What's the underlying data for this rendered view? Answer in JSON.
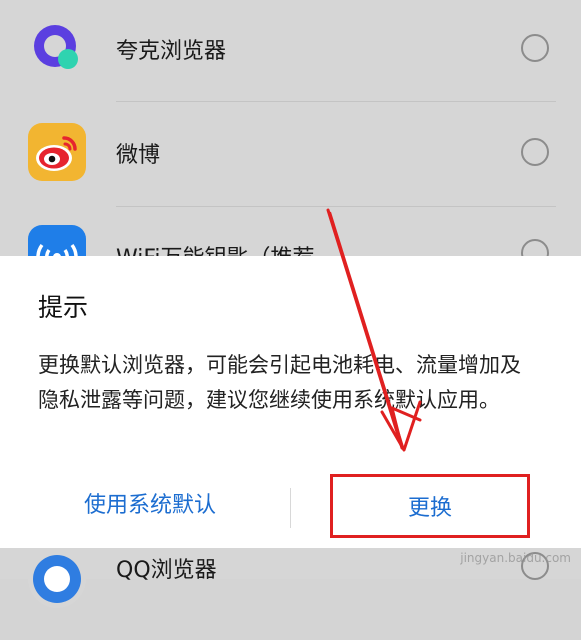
{
  "apps": [
    {
      "name": "夸克浏览器",
      "icon": "quark-browser-icon"
    },
    {
      "name": "微博",
      "icon": "weibo-icon"
    },
    {
      "name": "WiFi万能钥匙（推荐",
      "icon": "wifi-key-icon"
    },
    {
      "name": "QQ浏览器",
      "icon": "qq-browser-icon"
    }
  ],
  "dialog": {
    "title": "提示",
    "message": "更换默认浏览器，可能会引起电池耗电、流量增加及隐私泄露等问题，建议您继续使用系统默认应用。",
    "cancel_label": "使用系统默认",
    "confirm_label": "更换"
  },
  "watermark": "jingyan.baidu.com",
  "colors": {
    "accent": "#1c6dd0",
    "highlight": "#e02020"
  }
}
